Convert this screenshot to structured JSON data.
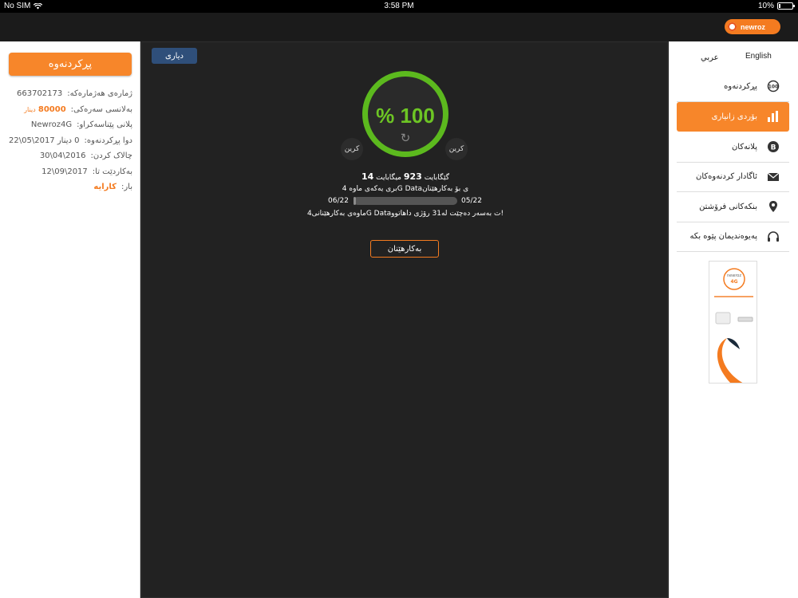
{
  "status_bar": {
    "carrier": "No SIM",
    "time": "3:58 PM",
    "battery": "10%",
    "battery_level": 0.1
  },
  "brand": {
    "logo_text": "newroz",
    "accent": "#f7862a",
    "gauge_color": "#5cb91e"
  },
  "left_panel": {
    "refill_button": "پڕکردنەوە",
    "rows": [
      {
        "label": "ژمارەی هەژمارەکە:",
        "value": "663702173"
      },
      {
        "label": "بەلانسی سەرەکی:",
        "value": "80000",
        "unit": "دینار"
      },
      {
        "label": "پلانی پێناسەکراو:",
        "value": "Newroz4G"
      },
      {
        "label": "دوا پڕکردنەوە:",
        "value": "0 دینار 2017\\05\\22"
      },
      {
        "label": "چالاک کردن:",
        "value": "2016\\04\\30"
      },
      {
        "label": "بەکاردێت تا:",
        "value": "2017\\09\\12"
      },
      {
        "label": "بار:",
        "value": "کارایە"
      }
    ]
  },
  "main": {
    "gift_button": "دیاری",
    "gauge": {
      "percent_text": "% 100",
      "percent_value": 100
    },
    "chip_left": "کرین",
    "chip_right": "کرین",
    "remaining": {
      "gb": "14",
      "gb_unit": "گێگابایت",
      "mb": "923",
      "mb_unit": "میگابایت"
    },
    "period_text": "بری یەکەی ماوە 4G Dataی بۆ بەکارهێنان",
    "start_date": "05/22",
    "end_date": "06/22",
    "usage_fraction": 0.02,
    "expiry_text": "ماوەی بەکارهێنانی4G Dataت بەسەر دەچێت لە31 رۆژی داهاتوو!",
    "use_button": "بەکارهێنان"
  },
  "right_panel": {
    "lang_en": "English",
    "lang_ar": "عربي",
    "menu": [
      {
        "label": "پڕکردنەوە",
        "icon": "refill-icon",
        "active": false
      },
      {
        "label": "بۆردی زانیاری",
        "icon": "bar-chart-icon",
        "active": true
      },
      {
        "label": "پلانەکان",
        "icon": "plans-icon",
        "active": false
      },
      {
        "label": "ئاگادار کردنەوەکان",
        "icon": "envelope-icon",
        "active": false
      },
      {
        "label": "بنکەکانی فرۆشتن",
        "icon": "location-pin-icon",
        "active": false
      },
      {
        "label": "پەیوەندیمان پێوە بکە",
        "icon": "headset-icon",
        "active": false
      }
    ],
    "banner_logo": "newroz 4G"
  }
}
